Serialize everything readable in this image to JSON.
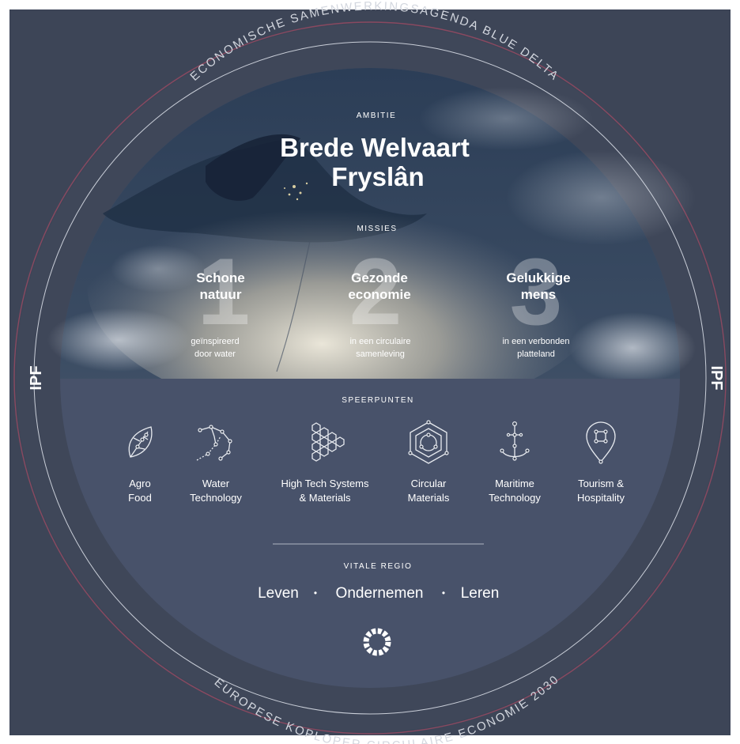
{
  "ring": {
    "top_text": "ECONOMISCHE SAMENWERKINGSAGENDA BLUE DELTA",
    "bottom_text": "EUROPESE KOPLOPER CIRCULAIRE ECONOMIE 2030",
    "left_logo": "IPF",
    "right_logo": "IPF"
  },
  "ambitie": {
    "label": "AMBITIE",
    "title_line1": "Brede Welvaart",
    "title_line2": "Fryslân"
  },
  "missies": {
    "label": "MISSIES",
    "items": [
      {
        "number": "1",
        "title_line1": "Schone",
        "title_line2": "natuur",
        "sub_line1": "geïnspireerd",
        "sub_line2": "door water"
      },
      {
        "number": "2",
        "title_line1": "Gezonde",
        "title_line2": "economie",
        "sub_line1": "in een circulaire",
        "sub_line2": "samenleving"
      },
      {
        "number": "3",
        "title_line1": "Gelukkige",
        "title_line2": "mens",
        "sub_line1": "in een verbonden",
        "sub_line2": "platteland"
      }
    ]
  },
  "speerpunten": {
    "label": "SPEERPUNTEN",
    "items": [
      {
        "icon": "leaf-icon",
        "line1": "Agro",
        "line2": "Food"
      },
      {
        "icon": "water-network-icon",
        "line1": "Water",
        "line2": "Technology"
      },
      {
        "icon": "hexagon-cluster-icon",
        "line1": "High Tech Systems",
        "line2": "& Materials"
      },
      {
        "icon": "circular-hexagon-icon",
        "line1": "Circular",
        "line2": "Materials"
      },
      {
        "icon": "anchor-icon",
        "line1": "Maritime",
        "line2": "Technology"
      },
      {
        "icon": "location-pin-icon",
        "line1": "Tourism &",
        "line2": "Hospitality"
      }
    ]
  },
  "vitale_regio": {
    "label": "VITALE REGIO",
    "items": [
      "Leven",
      "Ondernemen",
      "Leren"
    ],
    "separator": "•"
  },
  "colors": {
    "outer_square": "#3d4557",
    "ring": "#3f4759",
    "inner_disc": "#48526a",
    "accent_ring": "#8a4960",
    "thin_line": "#c9ced8",
    "text": "#ffffff"
  },
  "footer_icon": "circular-economy-icon"
}
